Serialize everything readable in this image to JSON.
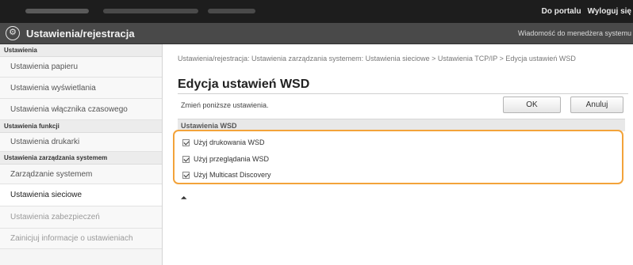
{
  "topbar": {
    "portal_link": "Do portalu",
    "logout_link": "Wyloguj się"
  },
  "header": {
    "title": "Ustawienia/rejestracja",
    "message_link": "Wiadomość do menedżera systemu",
    "app_icon": "wrench-gear-icon"
  },
  "sidebar": {
    "sections": [
      {
        "heading": "Ustawienia",
        "items": [
          {
            "label": "Ustawienia papieru"
          },
          {
            "label": "Ustawienia wyświetlania"
          },
          {
            "label": "Ustawienia włącznika czasowego"
          }
        ]
      },
      {
        "heading": "Ustawienia funkcji",
        "items": [
          {
            "label": "Ustawienia drukarki"
          }
        ]
      },
      {
        "heading": "Ustawienia zarządzania systemem",
        "items": [
          {
            "label": "Zarządzanie systemem"
          },
          {
            "label": "Ustawienia sieciowe"
          },
          {
            "label": "Ustawienia zabezpieczeń"
          },
          {
            "label": "Zainicjuj informacje o ustawieniach"
          }
        ]
      }
    ]
  },
  "main": {
    "breadcrumb": "Ustawienia/rejestracja: Ustawienia zarządzania systemem: Ustawienia sieciowe > Ustawienia TCP/IP > Edycja ustawień WSD",
    "page_title": "Edycja ustawień WSD",
    "instruction": "Zmień poniższe ustawienia.",
    "ok_label": "OK",
    "cancel_label": "Anuluj",
    "section_heading": "Ustawienia WSD",
    "options": [
      {
        "label": "Użyj drukowania WSD",
        "checked": true
      },
      {
        "label": "Użyj przeglądania WSD",
        "checked": true
      },
      {
        "label": "Użyj Multicast Discovery",
        "checked": true
      }
    ],
    "top_arrow": "⏶"
  },
  "colors": {
    "highlight": "#f3a33a",
    "topbar": "#1d1d1d",
    "titlebar": "#494949"
  }
}
